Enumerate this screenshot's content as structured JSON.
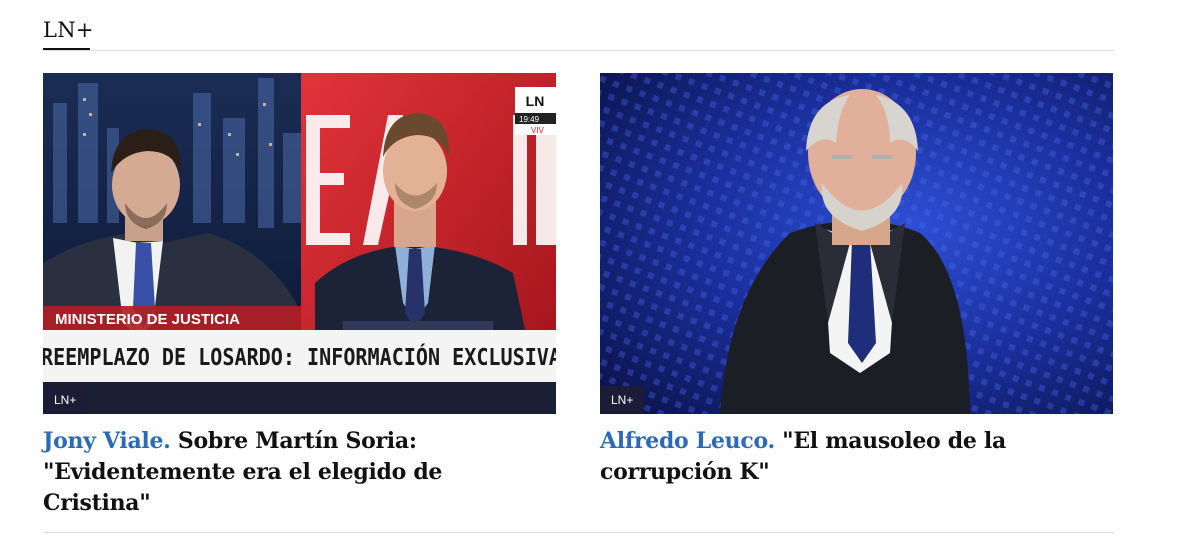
{
  "section": {
    "title": "LN+"
  },
  "articles": [
    {
      "author": "Jony Viale.",
      "title": "Sobre Martín Soria: \"Evidentemente era el elegido de Cristina\"",
      "badge": "LN+",
      "image": {
        "chyron_top": "MINISTERIO DE JUSTICIA",
        "chyron_main": "REEMPLAZO DE LOSARDO: INFORMACIÓN EXCLUSIVA",
        "channel_logo": "LN",
        "clock": "19:49",
        "live": "VIV"
      }
    },
    {
      "author": "Alfredo Leuco.",
      "title": "\"El mausoleo de la corrupción K\"",
      "badge": "LN+"
    }
  ],
  "colors": {
    "author": "#2a6ab8",
    "badge_bg": "#1c1c38",
    "rule": "#dcdcdc"
  }
}
